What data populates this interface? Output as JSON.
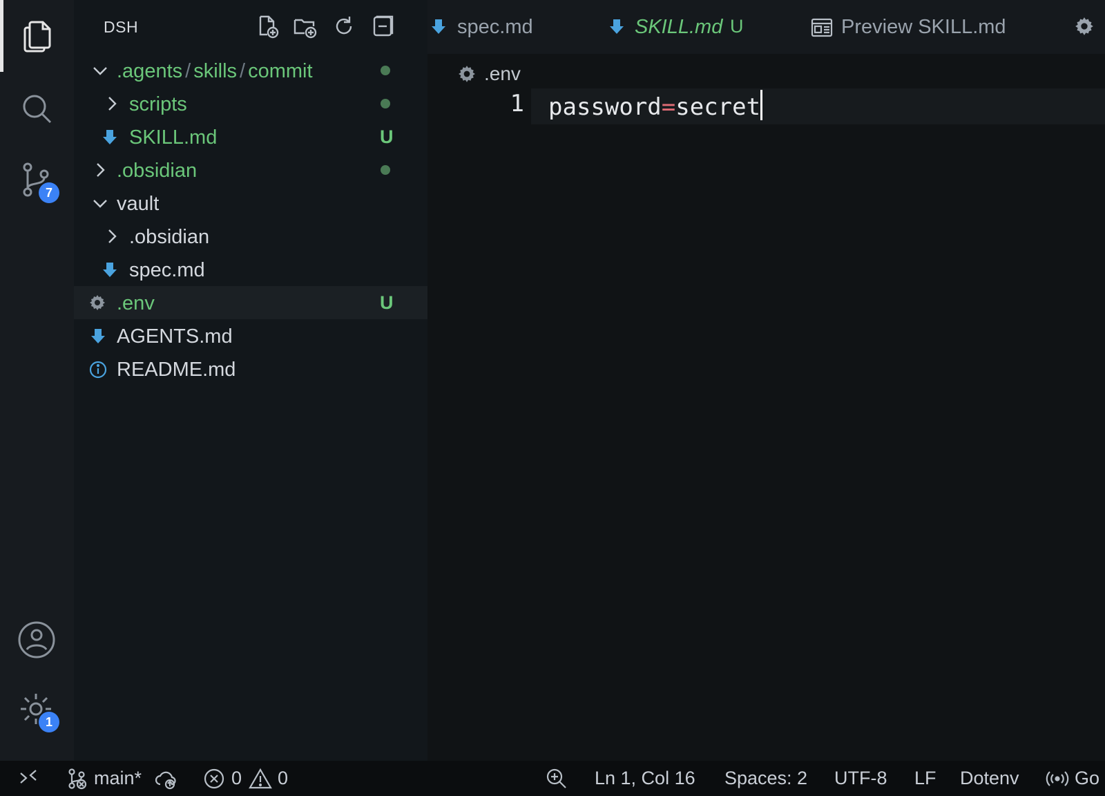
{
  "activity_bar": {
    "source_control_badge": "7",
    "settings_badge": "1"
  },
  "explorer": {
    "title": "DSH",
    "items": [
      {
        "path_parts": [
          ".agents",
          "skills",
          "commit"
        ]
      },
      {
        "label": "scripts"
      },
      {
        "label": "SKILL.md",
        "status": "U"
      },
      {
        "label": ".obsidian"
      },
      {
        "label": "vault"
      },
      {
        "label": ".obsidian"
      },
      {
        "label": "spec.md"
      },
      {
        "label": ".env",
        "status": "U"
      },
      {
        "label": "AGENTS.md"
      },
      {
        "label": "README.md"
      }
    ]
  },
  "tabs": [
    {
      "label": "spec.md"
    },
    {
      "label": "SKILL.md",
      "status": "U"
    },
    {
      "label": "Preview SKILL.md"
    }
  ],
  "editor": {
    "breadcrumb": ".env",
    "line_number": "1",
    "code_key": "password",
    "code_op": "=",
    "code_value": "secret"
  },
  "statusbar": {
    "branch": "main*",
    "errors": "0",
    "warnings": "0",
    "position": "Ln 1, Col 16",
    "spaces": "Spaces: 2",
    "encoding": "UTF-8",
    "eol": "LF",
    "language": "Dotenv",
    "golive": "Go"
  },
  "colors": {
    "git_untracked": "#6bc77a",
    "badge": "#3b82f6",
    "markdown_icon": "#4aa3df"
  }
}
